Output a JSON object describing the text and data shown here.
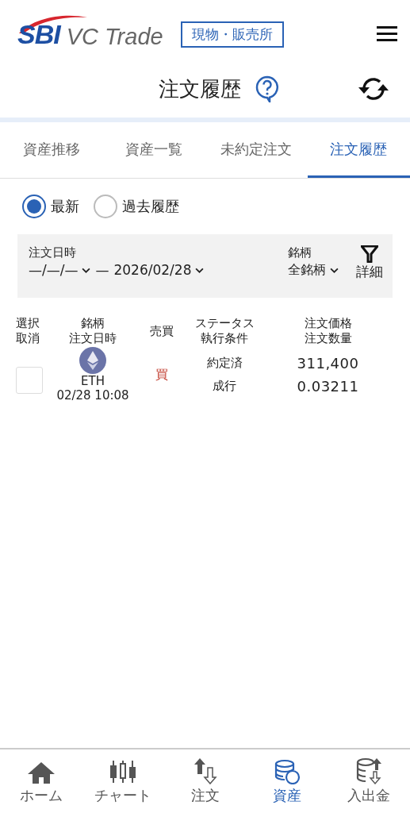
{
  "header": {
    "logo_mark": "SBI",
    "logo_text": "VC Trade",
    "market_badge": "現物・販売所"
  },
  "page_title": "注文履歴",
  "tabs": [
    {
      "label": "資産推移",
      "selected": false
    },
    {
      "label": "資産一覧",
      "selected": false
    },
    {
      "label": "未約定注文",
      "selected": false
    },
    {
      "label": "注文履歴",
      "selected": true
    }
  ],
  "period_options": [
    {
      "label": "最新",
      "selected": true
    },
    {
      "label": "過去履歴",
      "selected": false
    }
  ],
  "filter": {
    "date_label": "注文日時",
    "date_from": "—/—/—",
    "date_separator": "—",
    "date_to": "2026/02/28",
    "symbol_label": "銘柄",
    "symbol_value": "全銘柄",
    "detail_button": "詳細"
  },
  "table": {
    "columns": [
      {
        "lines": [
          "選択",
          "取消"
        ]
      },
      {
        "lines": [
          "銘柄",
          "注文日時"
        ]
      },
      {
        "lines": [
          "売買"
        ]
      },
      {
        "lines": [
          "ステータス",
          "執行条件"
        ]
      },
      {
        "lines": [
          "注文価格",
          "注文数量"
        ]
      }
    ],
    "rows": [
      {
        "checked": false,
        "symbol": "ETH",
        "date": "02/28 10:08",
        "side": "買",
        "status": "約定済",
        "condition": "成行",
        "price": "311,400",
        "quantity": "0.03211"
      }
    ]
  },
  "bottom_nav": [
    {
      "label": "ホーム",
      "kind": "home",
      "selected": false
    },
    {
      "label": "チャート",
      "kind": "chart",
      "selected": false
    },
    {
      "label": "注文",
      "kind": "order",
      "selected": false
    },
    {
      "label": "資産",
      "kind": "assets",
      "selected": true
    },
    {
      "label": "入出金",
      "kind": "transfer",
      "selected": false
    }
  ]
}
